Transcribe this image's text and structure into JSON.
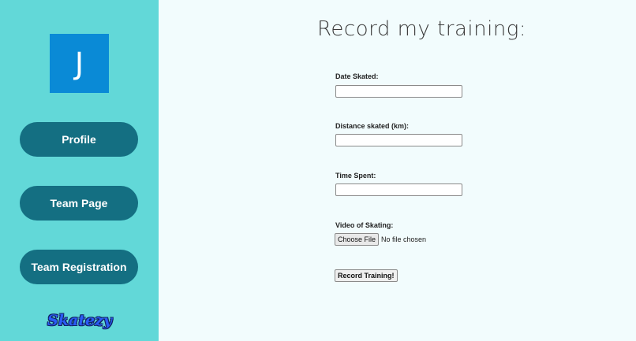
{
  "sidebar": {
    "avatar_initial": "J",
    "nav": [
      {
        "label": "Profile"
      },
      {
        "label": "Team Page"
      },
      {
        "label": "Team Registration"
      }
    ],
    "logo_text": "Skatezy"
  },
  "main": {
    "title": "Record my training:",
    "form": {
      "date_label": "Date Skated:",
      "date_value": "",
      "distance_label": "Distance skated (km):",
      "distance_value": "",
      "time_label": "Time Spent:",
      "time_value": "",
      "video_label": "Video of Skating:",
      "file_button_label": "Choose File",
      "file_status": "No file chosen",
      "submit_label": "Record Training!"
    }
  },
  "colors": {
    "sidebar_bg": "#62d8d8",
    "nav_button_bg": "#146f82",
    "avatar_bg": "#0a8ad6",
    "main_bg": "#f2fcfd",
    "logo": "#2a5cf5"
  }
}
